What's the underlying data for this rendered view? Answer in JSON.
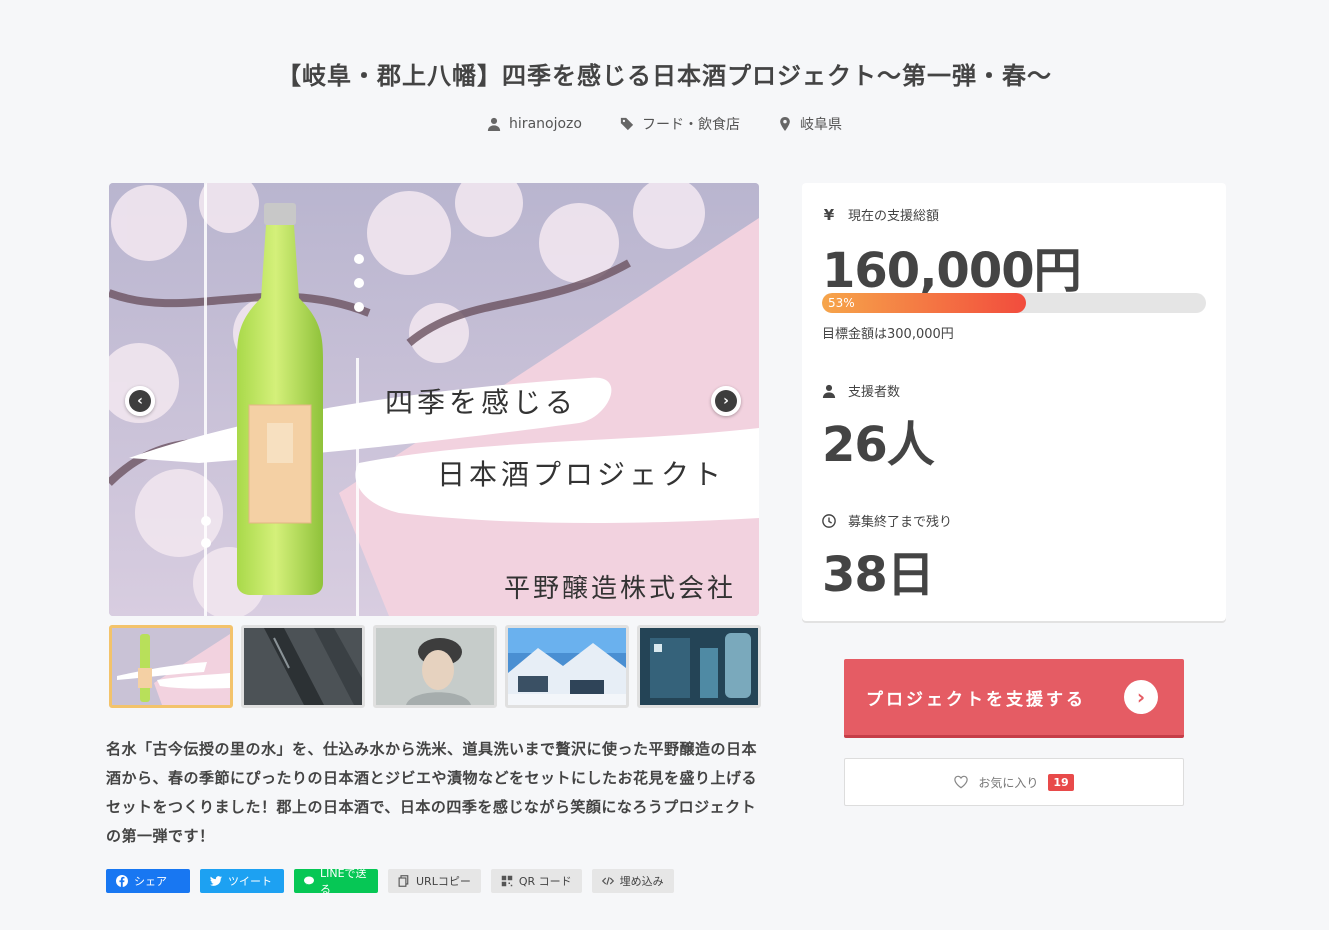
{
  "project": {
    "title": "【岐阜・郡上八幡】四季を感じる日本酒プロジェクト〜第一弾・春〜",
    "owner": "hiranojozo",
    "category": "フード・飲食店",
    "location": "岐阜県"
  },
  "hero": {
    "line1": "四季を感じる",
    "line2": "日本酒プロジェクト",
    "company": "平野醸造株式会社",
    "prev_icon": "chevron-left-icon",
    "next_icon": "chevron-right-icon"
  },
  "thumbnails": [
    {
      "name": "thumb-sake-bottle",
      "active": true
    },
    {
      "name": "thumb-dark-fabric",
      "active": false
    },
    {
      "name": "thumb-brewer-portrait",
      "active": false
    },
    {
      "name": "thumb-snowy-village",
      "active": false
    },
    {
      "name": "thumb-brewery-interior",
      "active": false
    }
  ],
  "description": "名水「古今伝授の里の水」を、仕込み水から洗米、道具洗いまで贅沢に使った平野醸造の日本酒から、春の季節にぴったりの日本酒とジビエや漬物などをセットにしたお花見を盛り上げるセットをつくりました！郡上の日本酒で、日本の四季を感じながら笑顔になろうプロジェクトの第一弾です！",
  "share": {
    "facebook": "シェア",
    "twitter": "ツイート",
    "line": "LINEで送る",
    "url_copy": "URLコピー",
    "qr": "QR コード",
    "embed": "埋め込み"
  },
  "stats": {
    "amount_label": "現在の支援総額",
    "amount": "160,000円",
    "percent_label": "53%",
    "percent": 53,
    "goal": "目標金額は300,000円",
    "backers_label": "支援者数",
    "backers": "26人",
    "remaining_label": "募集終了まで残り",
    "remaining": "38日"
  },
  "actions": {
    "support": "プロジェクトを支援する",
    "favorite": "お気に入り",
    "favorite_count": "19"
  },
  "colors": {
    "accent": "#e55c64",
    "facebook": "#1877f2",
    "twitter": "#1da1f2",
    "line": "#06c755"
  }
}
